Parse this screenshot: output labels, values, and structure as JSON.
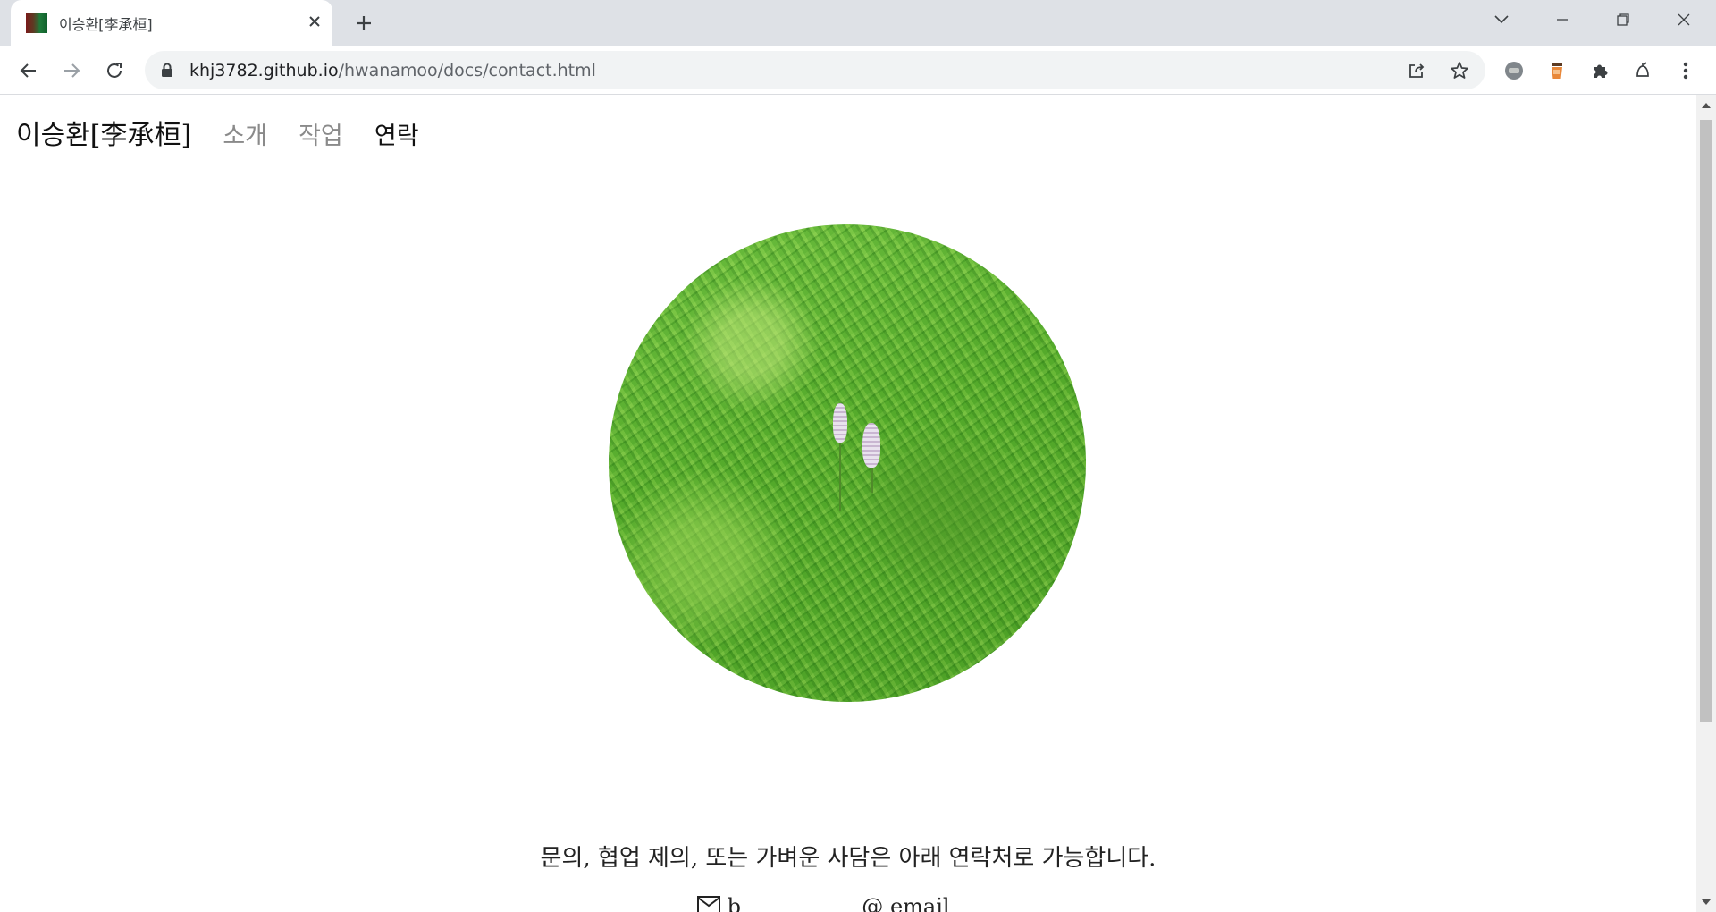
{
  "browser": {
    "tab_title": "이승환[李承桓]",
    "url_host": "khj3782.github.io",
    "url_path": "/hwanamoo/docs/contact.html"
  },
  "site": {
    "brand": "이승환[李承桓]",
    "nav": [
      "소개",
      "작업",
      "연락"
    ],
    "active_nav": "연락",
    "photo_alt": "grass",
    "message": "문의, 협업 제의, 또는 가벼운 사담은 아래 연락처로 가능합니다.",
    "contact_mail_label": "b",
    "contact_email_label": "email"
  },
  "icons": {
    "back": "arrow-left-icon",
    "forward": "arrow-right-icon",
    "reload": "reload-icon",
    "lock": "lock-icon",
    "share": "share-icon",
    "star": "star-icon",
    "extensions": [
      "dnl-extension-icon",
      "coffee-extension-icon",
      "puzzle-icon",
      "bell-extension-icon"
    ],
    "menu": "kebab-menu-icon"
  },
  "colors": {
    "tabbar_bg": "#dee1e6",
    "omnibox_bg": "#f1f3f4",
    "nav_inactive": "#8a8a8a",
    "nav_active": "#111111"
  }
}
